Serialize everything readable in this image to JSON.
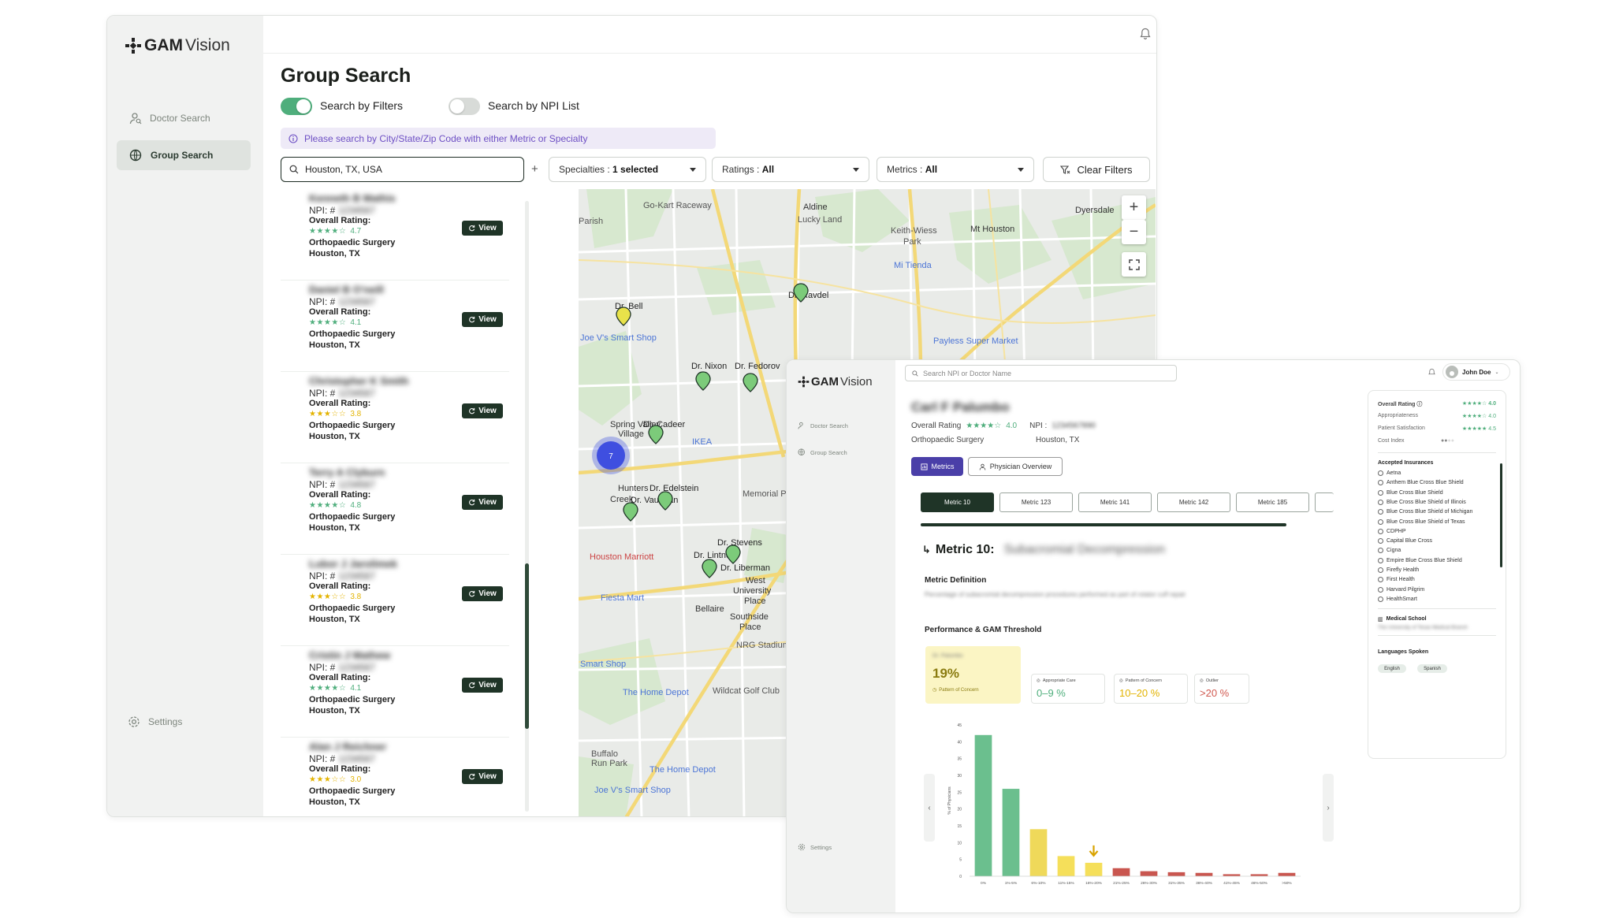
{
  "brand": {
    "logo_text": "GAM",
    "logo_suffix": "Vision"
  },
  "user": {
    "name": "John Doe"
  },
  "nav": {
    "doctor_search": "Doctor Search",
    "group_search": "Group Search",
    "settings": "Settings"
  },
  "group_search": {
    "title": "Group Search",
    "toggle_filters_label": "Search by Filters",
    "toggle_npi_label": "Search by NPI List",
    "info_text": "Please search by City/State/Zip Code with either Metric or Specialty",
    "search_value": "Houston, TX, USA",
    "add_symbol": "+",
    "filters": {
      "specialties_label": "Specialties :",
      "specialties_value": "1 selected",
      "ratings_label": "Ratings :",
      "ratings_value": "All",
      "metrics_label": "Metrics :",
      "metrics_value": "All",
      "clear_label": "Clear Filters"
    },
    "npi_prefix": "NPI: #",
    "rating_label": "Overall Rating:",
    "view_label": "View",
    "results": [
      {
        "name": "Kenneth B Mathis",
        "npi": "1234567",
        "rating": "4.7",
        "stars": "★★★★☆",
        "specialty": "Orthopaedic Surgery",
        "city": "Houston, TX"
      },
      {
        "name": "Daniel B O'neill",
        "npi": "1234567",
        "rating": "4.1",
        "stars": "★★★★☆",
        "specialty": "Orthopaedic Surgery",
        "city": "Houston, TX"
      },
      {
        "name": "Christopher K Smith",
        "npi": "1234567",
        "rating": "3.8",
        "stars": "★★★☆☆",
        "specialty": "Orthopaedic Surgery",
        "city": "Houston, TX"
      },
      {
        "name": "Terry A Clyburn",
        "npi": "1234567",
        "rating": "4.8",
        "stars": "★★★★☆",
        "specialty": "Orthopaedic Surgery",
        "city": "Houston, TX"
      },
      {
        "name": "Lubor J Jarolimek",
        "npi": "1234567",
        "rating": "3.8",
        "stars": "★★★☆☆",
        "specialty": "Orthopaedic Surgery",
        "city": "Houston, TX"
      },
      {
        "name": "Cristin J Mathew",
        "npi": "1234567",
        "rating": "4.1",
        "stars": "★★★★☆",
        "specialty": "Orthopaedic Surgery",
        "city": "Houston, TX"
      },
      {
        "name": "Alan J Reichner",
        "npi": "1234567",
        "rating": "3.0",
        "stars": "★★★☆☆",
        "specialty": "Orthopaedic Surgery",
        "city": "Houston, TX"
      }
    ]
  },
  "map": {
    "places": [
      {
        "label": "Go-Kart Raceway"
      },
      {
        "label": "Aldine"
      },
      {
        "label": "Lucky Land"
      },
      {
        "label": "Dyersdale"
      },
      {
        "label": "Mt Houston"
      },
      {
        "label": "Keith-Wiess Park"
      },
      {
        "label": "Mi Tienda"
      },
      {
        "label": "Dr. Bell"
      },
      {
        "label": "Dr. Ravdel"
      },
      {
        "label": "Joe V's Smart Shop"
      },
      {
        "label": "Payless Super Market"
      },
      {
        "label": "Dr. Nixon"
      },
      {
        "label": "Dr. Fedorov"
      },
      {
        "label": "Spring Valley Village"
      },
      {
        "label": "Dr. Cadeer"
      },
      {
        "label": "IKEA"
      },
      {
        "label": "Hunters Creek"
      },
      {
        "label": "Dr. Edelstein"
      },
      {
        "label": "Dr. Vaughan"
      },
      {
        "label": "Memorial Park"
      },
      {
        "label": "Dr. Stevens"
      },
      {
        "label": "Dr. Lintner"
      },
      {
        "label": "Dr. Liberman"
      },
      {
        "label": "West University Place"
      },
      {
        "label": "Fiesta Mart"
      },
      {
        "label": "Bellaire"
      },
      {
        "label": "Southside Place"
      },
      {
        "label": "NRG Stadium"
      },
      {
        "label": "Smart Shop"
      },
      {
        "label": "The Home Depot"
      },
      {
        "label": "Wildcat Golf Club"
      },
      {
        "label": "Buffalo Run Park"
      },
      {
        "label": "The Home Depot"
      },
      {
        "label": "Joe V's Smart Shop"
      },
      {
        "label": "Parish"
      },
      {
        "label": "Houston Marriott"
      }
    ],
    "cluster_count": "7",
    "zoom_in": "+",
    "zoom_out": "−"
  },
  "detail": {
    "search_placeholder": "Search NPI or Doctor Name",
    "doctor_name": "Carl F Palumbo",
    "overall_rating_label": "Overall Rating",
    "overall_rating_value": "4.0",
    "npi_label": "NPI :",
    "npi_value": "1234567890",
    "specialty": "Orthopaedic Surgery",
    "city": "Houston, TX",
    "btn_metrics": "Metrics",
    "btn_physician": "Physician Overview",
    "metric_tabs": [
      "Metric 10",
      "Metric 123",
      "Metric 141",
      "Metric 142",
      "Metric 185"
    ],
    "metric_heading": "Metric 10:",
    "metric_heading_detail": "Subacromial Decompression",
    "metric_definition_title": "Metric Definition",
    "metric_definition_text": "Percentage of subacromial decompression procedures performed as part of rotator cuff repair",
    "performance_title": "Performance & GAM Threshold",
    "dr_label": "Dr. Palumbo",
    "dr_value": "19%",
    "dr_sub": "Pattern of Concern",
    "thresholds": [
      {
        "label": "Appropriate Care",
        "value": "0–9 %",
        "color": "#4fae7c"
      },
      {
        "label": "Pattern of Concern",
        "value": "10–20 %",
        "color": "#e3b300"
      },
      {
        "label": "Outlier",
        "value": ">20 %",
        "color": "#d0584f"
      }
    ],
    "chart_ylabel": "% of Physicians",
    "side": {
      "overall_rating_label": "Overall Rating",
      "overall_rating_value": "4.0",
      "appropriateness_label": "Appropriateness",
      "appropriateness_value": "4.0",
      "patient_sat_label": "Patient Satisfaction",
      "patient_sat_value": "4.5",
      "cost_index_label": "Cost Index",
      "accepted_ins_title": "Accepted Insurances",
      "insurances": [
        "Aetna",
        "Anthem Blue Cross Blue Shield",
        "Blue Cross Blue Shield",
        "Blue Cross Blue Shield of Illinois",
        "Blue Cross Blue Shield of Michigan",
        "Blue Cross Blue Shield of Texas",
        "CDPHP",
        "Capital Blue Cross",
        "Cigna",
        "Empire Blue Cross Blue Shield",
        "Firefly Health",
        "First Health",
        "Harvard Pilgrim",
        "HealthSmart"
      ],
      "medical_school_title": "Medical School",
      "medical_school_value": "The University of Texas Medical Branch",
      "languages_title": "Languages Spoken",
      "languages": [
        "English",
        "Spanish"
      ]
    }
  },
  "chart_data": {
    "type": "bar",
    "categories": [
      "0%",
      "1%-5%",
      "6%-10%",
      "11%-15%",
      "16%-20%",
      "21%-25%",
      "26%-30%",
      "31%-35%",
      "36%-40%",
      "41%-45%",
      "46%-50%",
      ">50%"
    ],
    "values": [
      42,
      26,
      14,
      6,
      4,
      2.4,
      1.5,
      1.2,
      1.0,
      0.6,
      0.6,
      1.0
    ],
    "ylabel": "% of Physicians",
    "xlabel": "",
    "ylim": [
      0,
      45
    ],
    "yticks": [
      0,
      5,
      10,
      15,
      20,
      25,
      30,
      35,
      40,
      45
    ],
    "colors": [
      "#6bbf8e",
      "#6bbf8e",
      "#efd95a",
      "#f5df5a",
      "#f5df5a",
      "#c9564f",
      "#c9564f",
      "#c9564f",
      "#c9564f",
      "#c9564f",
      "#c9564f",
      "#c9564f"
    ],
    "highlight_category": "16%-20%"
  }
}
